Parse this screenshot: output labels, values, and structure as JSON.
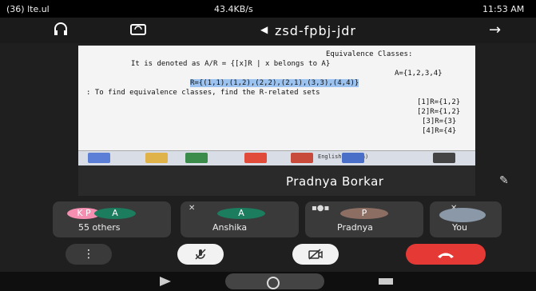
{
  "status_bar": {
    "time": "11:53 AM",
    "left_text": "43.4KB/s",
    "left_icons": "(36) lte.ul"
  },
  "top_bar": {
    "meeting_code": "zsd-fpbj-jdr",
    "back_icon": "arrow-icon",
    "switch_camera_icon": "camera-switch-icon",
    "audio_icon": "headphone-icon"
  },
  "shared_screen": {
    "lines": [
      "Equivalence Classes:",
      "It is denoted as  A/R = {[x]R |  x belongs to A}",
      "A={1,2,3,4}",
      "R={(1,1),(1,2),(2,2),(2,1),(3,3),(4,4)}",
      ": To find equivalence classes, find the R-related sets",
      "[1]R={1,2}",
      "[2]R={1,2}",
      "[3]R={3}",
      "[4]R={4}"
    ],
    "taskbar_text": "English (India)"
  },
  "presenter": {
    "name": "Pradnya Borkar"
  },
  "participants": [
    {
      "label": "55 others",
      "initials": [
        "A",
        "K P"
      ]
    },
    {
      "label": "Anshika",
      "initial": "A"
    },
    {
      "label": "Pradnya",
      "initial": "P"
    },
    {
      "label": "You",
      "initial": ""
    }
  ],
  "colors": {
    "end_call": "#e53935",
    "avatar_teal": "#1b7c5e",
    "avatar_pink": "#f48fb1",
    "avatar_brown": "#8d6e63"
  }
}
